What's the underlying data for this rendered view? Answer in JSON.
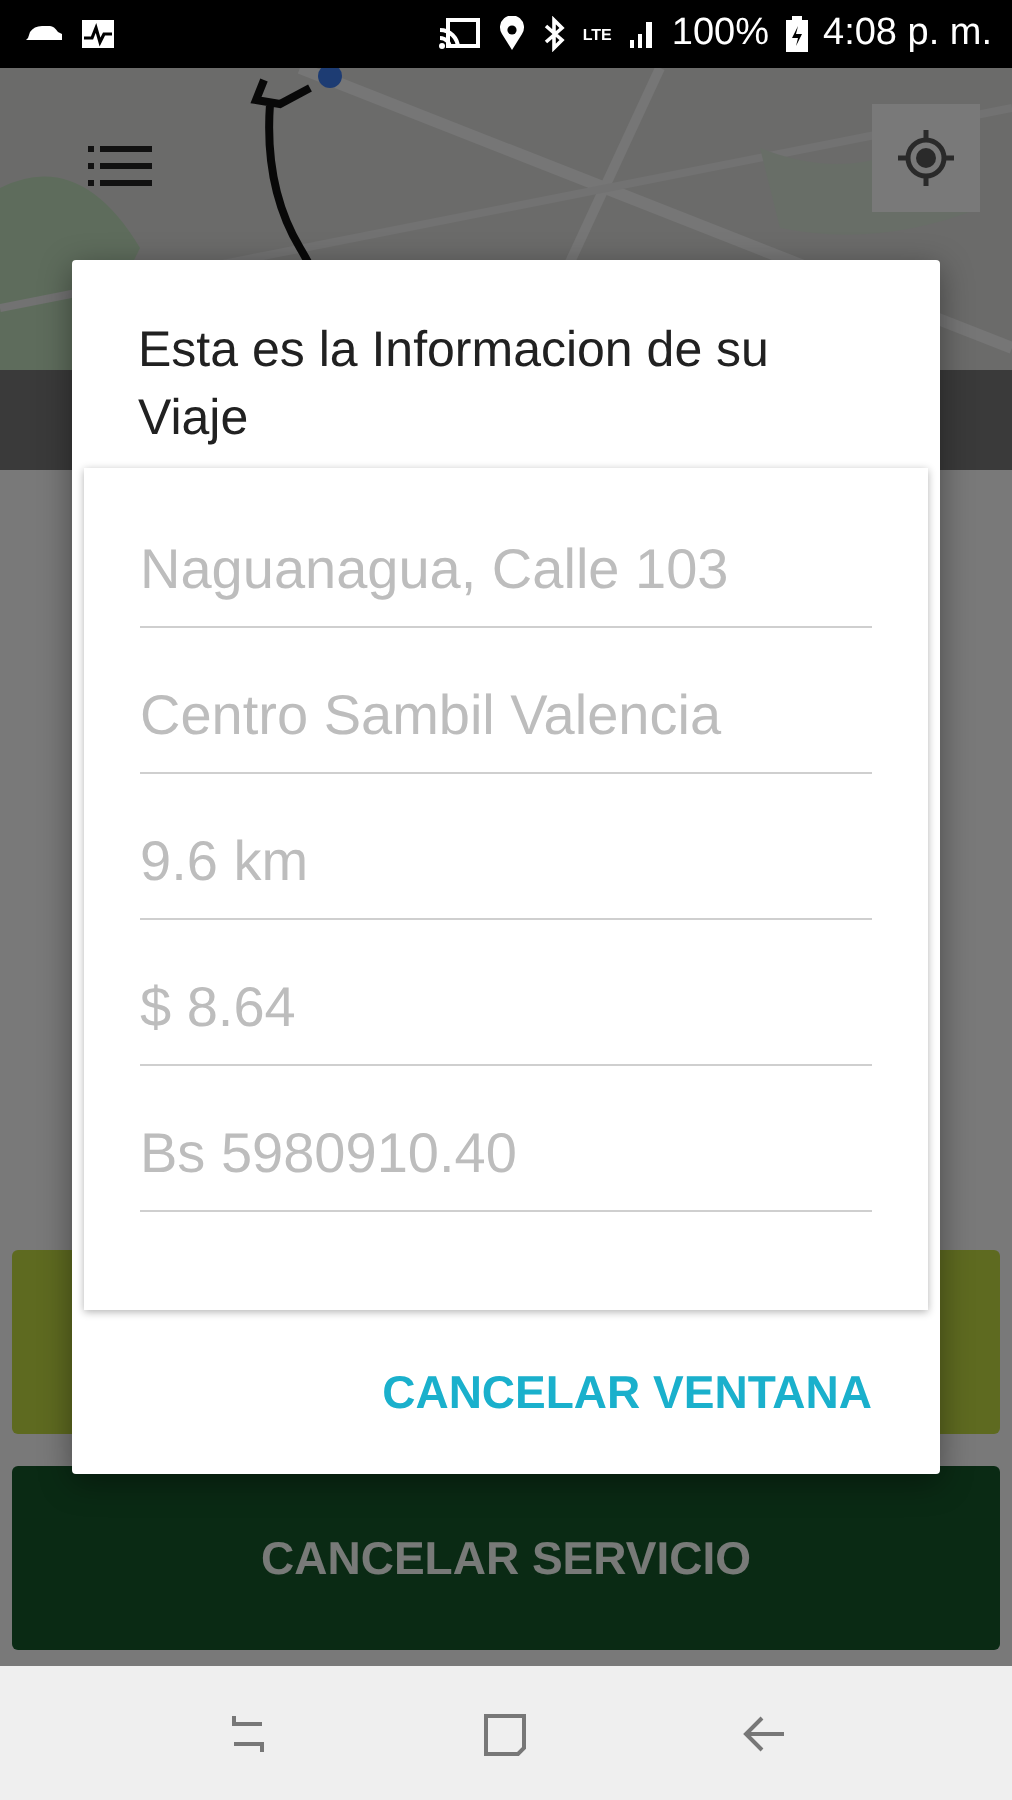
{
  "status_bar": {
    "network": "LTE",
    "battery": "100%",
    "time": "4:08 p. m."
  },
  "dialog": {
    "title": "Esta es la Informacion de su Viaje",
    "fields": [
      {
        "placeholder": "Naguanagua, Calle 103"
      },
      {
        "placeholder": "Centro Sambil Valencia"
      },
      {
        "placeholder": "9.6 km"
      },
      {
        "placeholder": "$ 8.64"
      },
      {
        "placeholder": "Bs 5980910.40"
      }
    ],
    "button": "CANCELAR VENTANA"
  },
  "buttons": [
    {
      "kind": "action"
    },
    {
      "kind": "cancel",
      "label": "CANCELAR SERVICIO"
    }
  ]
}
